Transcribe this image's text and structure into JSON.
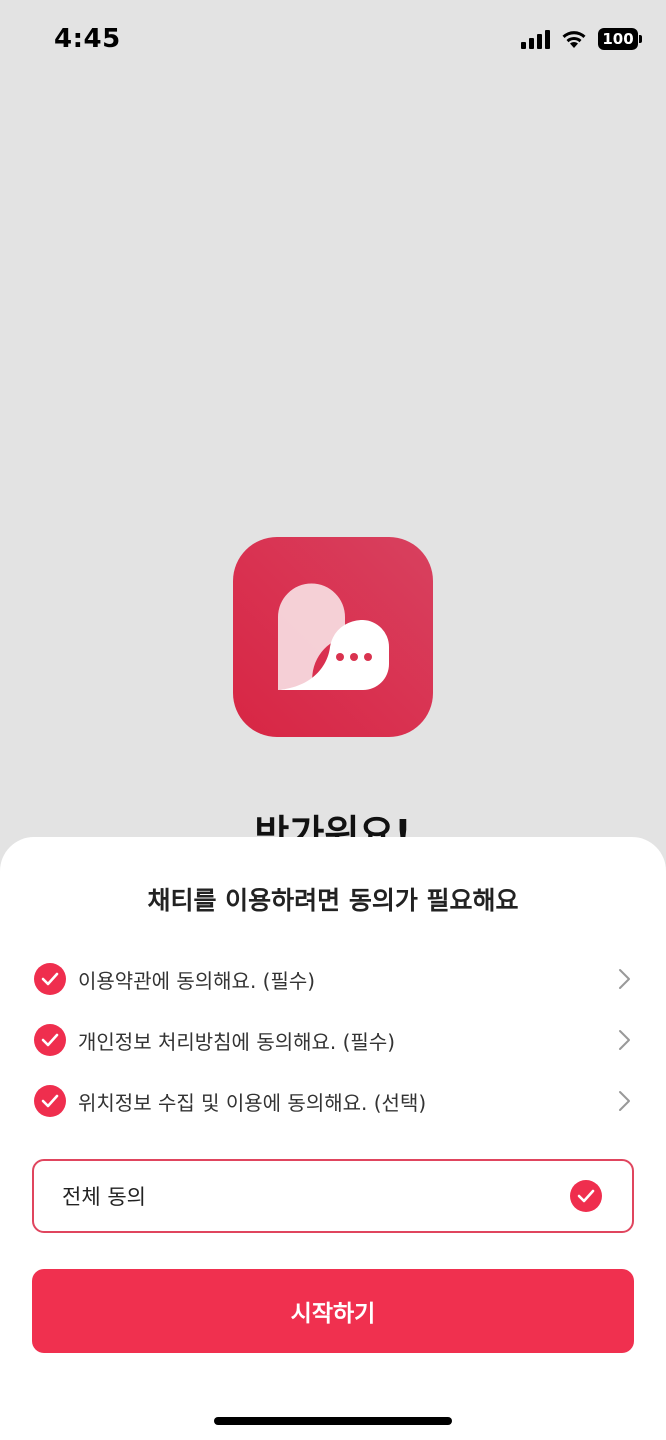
{
  "status_bar": {
    "time": "4:45",
    "battery": "100"
  },
  "welcome": {
    "title": "반가워요!"
  },
  "sheet": {
    "title": "채티를 이용하려면 동의가 필요해요",
    "items": [
      {
        "label": "이용약관에 동의해요. (필수)",
        "checked": true
      },
      {
        "label": "개인정보 처리방침에 동의해요. (필수)",
        "checked": true
      },
      {
        "label": "위치정보 수집 및 이용에 동의해요. (선택)",
        "checked": true
      }
    ],
    "all_agree_label": "전체 동의",
    "start_button": "시작하기"
  },
  "colors": {
    "accent": "#f0304f",
    "logo": "#d9334f",
    "backdrop": "#e3e3e3"
  }
}
